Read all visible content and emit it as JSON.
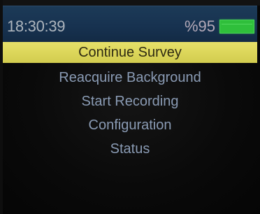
{
  "status_bar": {
    "time": "18:30:39",
    "battery_text": "%95",
    "battery_level": 0.95,
    "battery_icon": "battery-full-icon",
    "colors": {
      "background": "#173250",
      "battery": "#2fbf3b"
    }
  },
  "menu": {
    "selected_index": 0,
    "highlight_color": "#dcd65a",
    "items": [
      {
        "label": "Continue Survey"
      },
      {
        "label": "Reacquire Background"
      },
      {
        "label": "Start Recording"
      },
      {
        "label": "Configuration"
      },
      {
        "label": "Status"
      }
    ]
  }
}
